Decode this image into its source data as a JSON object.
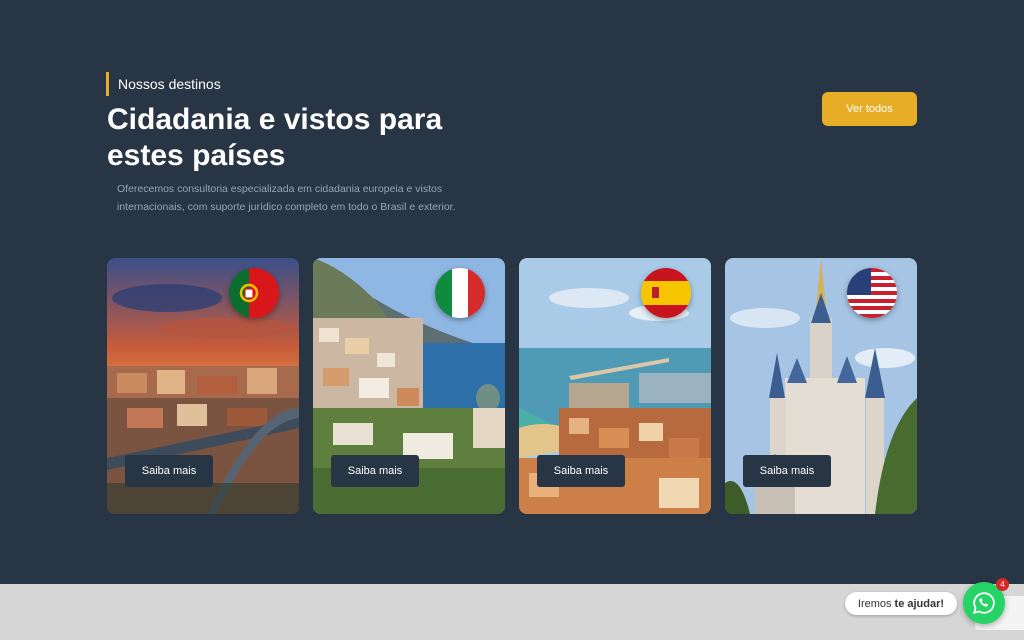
{
  "header": {
    "eyebrow": "Nossos destinos",
    "title": "Cidadania e vistos para estes países",
    "description": "Oferecemos consultoria especializada em cidadania europeia e vistos internacionais, com suporte jurídico completo em todo o Brasil e exterior.",
    "see_all_label": "Ver todos"
  },
  "cards": [
    {
      "country": "portugal",
      "flag_icon": "portugal-flag-icon",
      "button_label": "Saiba mais"
    },
    {
      "country": "italy",
      "flag_icon": "italy-flag-icon",
      "button_label": "Saiba mais"
    },
    {
      "country": "spain",
      "flag_icon": "spain-flag-icon",
      "button_label": "Saiba mais"
    },
    {
      "country": "usa",
      "flag_icon": "usa-flag-icon",
      "button_label": "Saiba mais"
    }
  ],
  "chat": {
    "text_prefix": "Iremos",
    "text_bold": "te ajudar!",
    "badge_count": "4",
    "icon": "whatsapp-icon"
  },
  "colors": {
    "background": "#283545",
    "accent": "#e8ad26",
    "whatsapp": "#25d366"
  }
}
